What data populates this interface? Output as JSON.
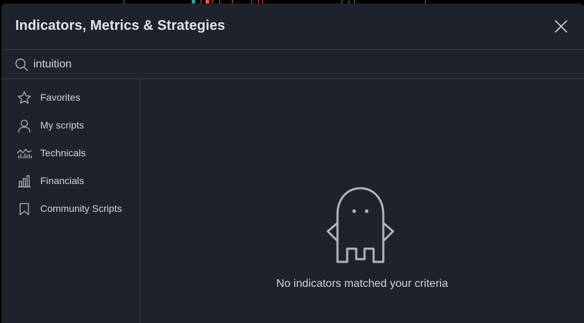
{
  "dialog": {
    "title": "Indicators, Metrics & Strategies"
  },
  "search": {
    "value": "intuition",
    "icon": "search-icon"
  },
  "sidebar": {
    "items": [
      {
        "label": "Favorites",
        "icon": "star-icon"
      },
      {
        "label": "My scripts",
        "icon": "user-icon"
      },
      {
        "label": "Technicals",
        "icon": "chart-line-icon"
      },
      {
        "label": "Financials",
        "icon": "bar-chart-icon"
      },
      {
        "label": "Community Scripts",
        "icon": "bookmark-icon"
      }
    ]
  },
  "empty_state": {
    "message": "No indicators matched your criteria",
    "icon": "ghost-icon"
  },
  "colors": {
    "dialog_bg": "#1e222d",
    "border": "#363a45",
    "text": "#d1d4dc",
    "title": "#e0e3eb",
    "icon": "#b2b5be"
  }
}
